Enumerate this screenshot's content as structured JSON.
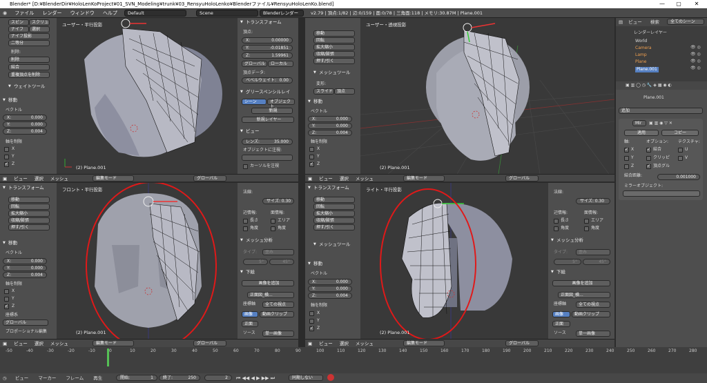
{
  "titlebar": {
    "title": "Blender* [D:¥BlenderDir¥HoloLenKoProject¥01_SVN_Modeling¥trunk¥03_RensyuHoloLenko¥Blenderファイル¥RensyuHoloLenKo.blend]"
  },
  "infobar": {
    "menus": [
      "ファイル",
      "レンダー",
      "ウィンドウ",
      "ヘルプ"
    ],
    "layout": "Default",
    "scene": "Scene",
    "engine": "Blenderレンダー",
    "stats": "v2.79 | 頂点:1/82 | 辺:0/159 | 面:0/78 | 三角面:118 | メモリ:30.87M | Plane.001"
  },
  "toolshelf_top": {
    "row1": [
      "スピン",
      "スクリュー"
    ],
    "row2": [
      "ナイフ",
      "選択"
    ],
    "knife_proj": "ナイフ投影",
    "bisect": "二等分",
    "remove_label": "削除:",
    "delete": "削除",
    "merge": "結合",
    "remove_doubles": "重複頂点を削除",
    "weight_tool": "ウェイトツール",
    "move_panel": "移動",
    "vector": "ベクトル",
    "x": "X:",
    "xv": "0.000",
    "y": "Y:",
    "yv": "0.000",
    "z": "Z:",
    "zv": "0.004",
    "constraint": "軸を制限",
    "axes": [
      "X",
      "Y",
      "Z"
    ]
  },
  "np_top": {
    "transform": "トランスフォーム",
    "vertex": "頂点:",
    "x": "X:",
    "xv": "0.00000",
    "y": "Y:",
    "yv": "-0.01851",
    "z": "Z:",
    "zv": "1.59961",
    "global": "グローバル",
    "local": "ローカル",
    "vertex_data": "頂点データ:",
    "bevel": "ベベルウェイト:",
    "bevel_v": "0.00",
    "gp_layer": "グリースペンシルレイ",
    "scene": "シーン",
    "object": "オブジェクト",
    "new": "新規",
    "new_layer": "新規レイヤー",
    "view": "ビュー",
    "lens": "レンズ:",
    "lens_v": "35.000",
    "lock": "オブジェクトに注視:",
    "cursor_lock": "カーソルを注視"
  },
  "vp_tl": {
    "title": "ユーザー・平行投影",
    "label": "(2) Plane.001"
  },
  "vp_tr": {
    "title": "ユーザー・透視投影",
    "label": "(2) Plane.001"
  },
  "vp_bl": {
    "title": "フロント・平行投影",
    "label": "(2) Plane.001"
  },
  "vp_br": {
    "title": "ライト・平行投影",
    "label": "(2) Plane.001"
  },
  "vhdr": {
    "view": "ビュー",
    "select": "選択",
    "mesh": "メッシュ",
    "mode": "編集モード",
    "orient": "グローバル"
  },
  "tools_tr": {
    "move": "移動",
    "rotate": "回転",
    "scale": "拡大縮小",
    "shrink": "収縮/膨張",
    "push": "押す/引く",
    "mesh_tools": "メッシュツール",
    "deform": "変形:",
    "slide": "スライド",
    "vertex": "頂点",
    "move_panel": "移動",
    "vector": "ベクトル",
    "x": "X:",
    "xv": "0.000",
    "y": "Y:",
    "yv": "0.000",
    "z": "Z:",
    "zv": "0.004",
    "constraint": "軸を制限",
    "axes": [
      "X",
      "Y",
      "Z"
    ]
  },
  "tools_bl": {
    "transform": "トランスフォーム",
    "move": "移動",
    "rotate": "回転",
    "scale": "拡大縮小",
    "shrink": "収縮/膨張",
    "push": "押す/引く",
    "move_panel": "移動",
    "vector": "ベクトル",
    "x": "X:",
    "xv": "0.000",
    "y": "Y:",
    "yv": "0.000",
    "z": "Z:",
    "zv": "0.004",
    "constraint": "軸を制限",
    "axes": [
      "X",
      "Y",
      "Z"
    ],
    "orient_label": "座標系",
    "orient": "グローバル",
    "prop": "プロポーショナル編集"
  },
  "np_bl": {
    "normals": "法線:",
    "size": "サイズ: 0.30",
    "edge_info": "辺情報:",
    "face_info": "面情報:",
    "length": "長さ",
    "angle": "角度",
    "area": "エリア",
    "angle2": "角度",
    "analysis": "メッシュ分析",
    "type": "タイプ:",
    "type_v": "歪み",
    "range_a": "5°",
    "range_b": "45°",
    "bottom": "下絵",
    "add_image": "画像を追加",
    "camera": "正面図_横...",
    "axis": "座標軸",
    "axis_v": "全ての視点",
    "image": "画像",
    "movie": "動画クリップ",
    "front": "正面",
    "source": "ソース",
    "source_v": "単一画像"
  },
  "tools_br": {
    "transform": "トランスフォーム",
    "move": "移動",
    "rotate": "回転",
    "scale": "拡大縮小",
    "shrink": "収縮/膨張",
    "push": "押す/引く",
    "mesh_tools": "メッシュツール",
    "move_panel": "移動",
    "vector": "ベクトル",
    "x": "X:",
    "xv": "0.000",
    "y": "Y:",
    "yv": "0.000",
    "z": "Z:",
    "zv": "0.004",
    "constraint": "軸を制限",
    "axes": [
      "X",
      "Y",
      "Z"
    ]
  },
  "outliner": {
    "menus": [
      "ビュー",
      "検索"
    ],
    "scene_select": "全てのシーン",
    "items": [
      "レンダーレイヤー",
      "World",
      "Camera",
      "Lamp",
      "Plane",
      "Plane.001"
    ]
  },
  "properties": {
    "object": "Plane.001",
    "add": "追加",
    "modifier": "Mir",
    "apply": "適用",
    "copy": "コピー",
    "axis": "軸:",
    "options": "オプション:",
    "texture": "テクスチャ:",
    "x": "X",
    "y": "Y",
    "z": "Z",
    "merge": "結合",
    "clip": "クリッピ",
    "vgroup": "頂点グル",
    "u": "U",
    "v": "V",
    "merge_limit": "結合距離:",
    "merge_limit_v": "0.001000",
    "mirror_obj": "ミラーオブジェクト:"
  },
  "timeline": {
    "ticks": [
      "-50",
      "-40",
      "-30",
      "-20",
      "-10",
      "0",
      "10",
      "20",
      "30",
      "40",
      "50",
      "60",
      "70",
      "80",
      "90",
      "100",
      "110",
      "120",
      "130",
      "140",
      "150",
      "160",
      "170",
      "180",
      "190",
      "200",
      "210",
      "220",
      "230",
      "240",
      "250",
      "260",
      "270",
      "280"
    ],
    "menus": [
      "ビュー",
      "マーカー",
      "フレーム",
      "再生"
    ],
    "start": "開始:",
    "start_v": "1",
    "end": "終了:",
    "end_v": "250",
    "current": "2",
    "sync": "同期しない"
  },
  "colors": {
    "accent": "#5680c2",
    "highlight": "#e01919"
  }
}
